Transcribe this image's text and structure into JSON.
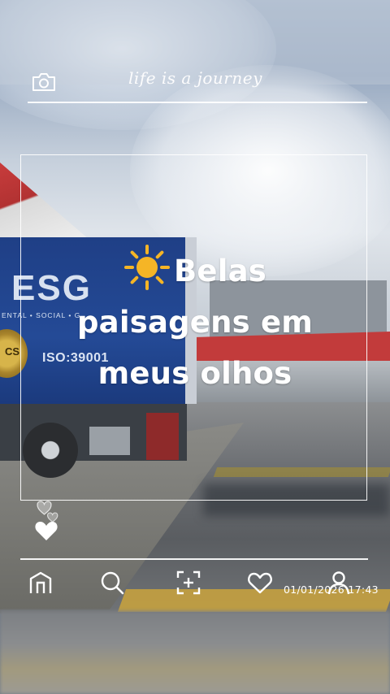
{
  "overlay": {
    "top_script_text": "life is a journey",
    "caption_lines": [
      "Belas",
      "paisagens em",
      "meus olhos"
    ],
    "caption_emoji": "sun-emoji",
    "timestamp": "01/01/2026 17:43"
  },
  "photo": {
    "truck_brand": "ESG",
    "truck_tagline": "ENTAL • SOCIAL • G",
    "truck_cert": "ISO:39001",
    "truck_badge": "CS"
  },
  "icons": {
    "top": "camera-icon",
    "side": [
      "hearts-outline-icon",
      "heart-filled-icon"
    ],
    "bottom_nav": [
      "home-icon",
      "search-icon",
      "add-frame-icon",
      "heart-icon",
      "profile-icon"
    ]
  },
  "colors": {
    "overlay_white": "#ffffff",
    "sun_yellow": "#f5b526",
    "truck_blue": "#244a96",
    "canopy_red": "#c23b3b"
  }
}
